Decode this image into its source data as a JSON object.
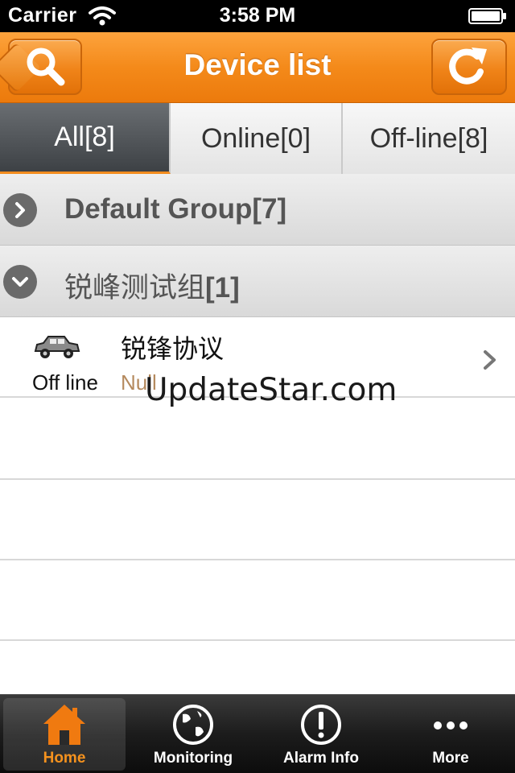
{
  "status_bar": {
    "carrier": "Carrier",
    "time": "3:58 PM"
  },
  "header": {
    "title": "Device list"
  },
  "tabs": [
    {
      "label": "All[8]",
      "active": true
    },
    {
      "label": "Online[0]",
      "active": false
    },
    {
      "label": "Off-line[8]",
      "active": false
    }
  ],
  "groups": [
    {
      "name": "Default Group[7]",
      "expanded": false
    },
    {
      "name_prefix": "锐峰测试组",
      "count": "[1]",
      "expanded": true
    }
  ],
  "devices": [
    {
      "name": "锐锋协议",
      "status": "Off line",
      "info": "Null"
    }
  ],
  "watermark": "UpdateStar.com",
  "tab_bar": {
    "items": [
      {
        "label": "Home",
        "icon": "home-icon",
        "active": true
      },
      {
        "label": "Monitoring",
        "icon": "globe-icon",
        "active": false
      },
      {
        "label": "Alarm Info",
        "icon": "alert-icon",
        "active": false
      },
      {
        "label": "More",
        "icon": "more-icon",
        "active": false
      }
    ]
  },
  "colors": {
    "accent": "#f28c1e",
    "nav_bar": "#f48a1a",
    "info_text": "#b58a5e"
  }
}
